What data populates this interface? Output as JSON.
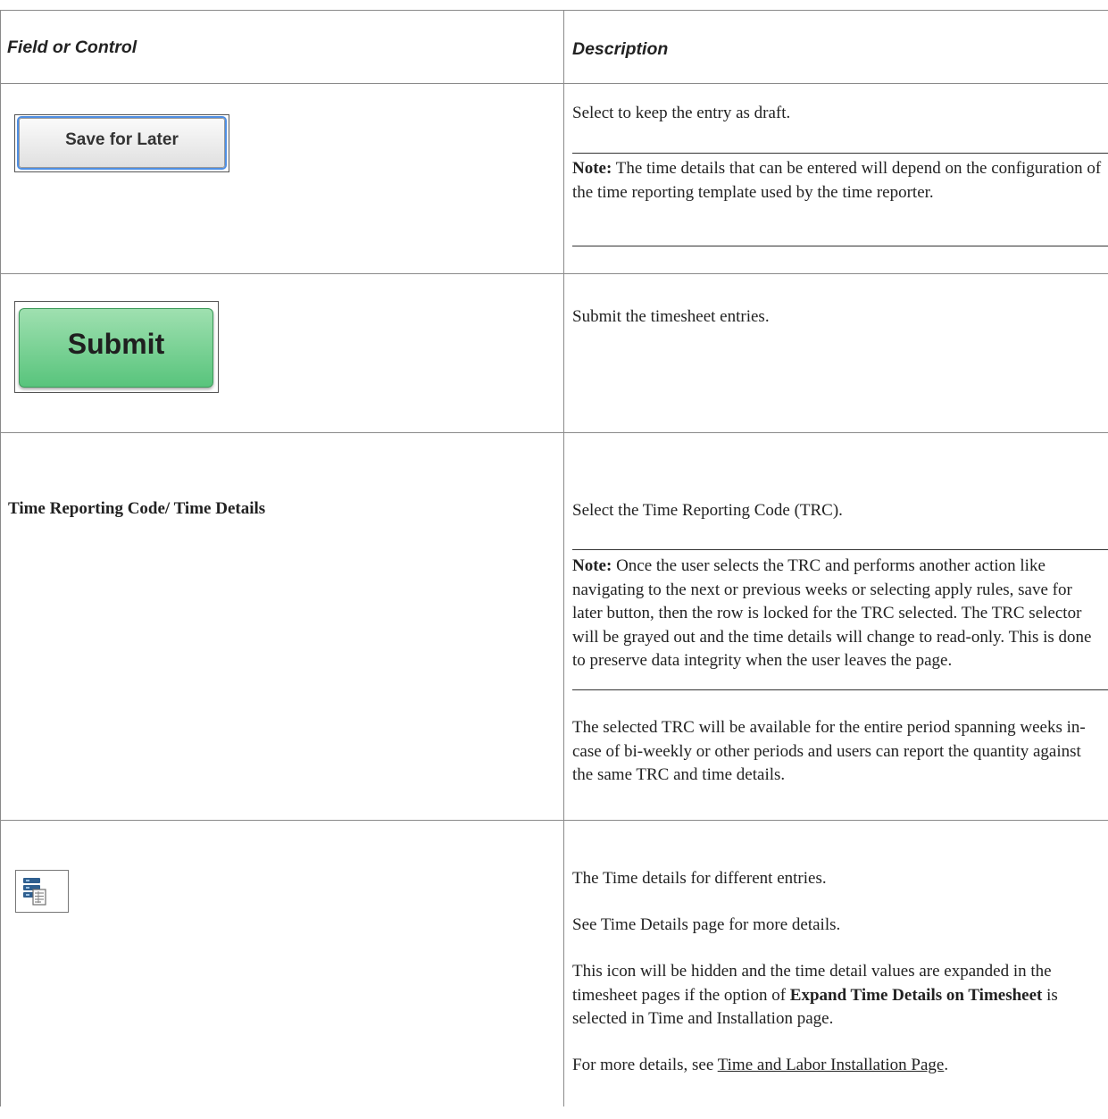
{
  "header": {
    "col1": "Field or Control",
    "col2": "Description"
  },
  "rows": [
    {
      "control": "Save for Later",
      "description": "Select to keep the entry as draft.",
      "note_label": "Note:",
      "note_text": " The time details that can be entered will depend on the configuration of the time reporting template used by the time reporter."
    },
    {
      "control": "Submit",
      "description": "Submit the timesheet entries."
    },
    {
      "control": "Time Reporting Code/ Time Details",
      "description": "Select the Time Reporting Code (TRC).",
      "note_label": "Note:",
      "note_text": " Once the user selects the TRC and performs another action like navigating to the next or previous weeks or selecting apply rules, save for later button, then the row is locked for the TRC selected. The TRC selector will be grayed out and the time details will change to read-only. This is done to preserve data integrity when the user leaves the page.",
      "extra": "The selected TRC will be available for the entire period spanning weeks in-case of bi-weekly or other periods and users can report the quantity against the same TRC and time details."
    },
    {
      "control_icon": "time-details-icon",
      "p1": "The Time details for different entries.",
      "p2": "See Time Details page for more details.",
      "p3_a": "This icon will be hidden and the time detail values are expanded in the timesheet pages if the option of ",
      "p3_bold": "Expand Time Details on Timesheet",
      "p3_b": " is selected in Time and Installation page.",
      "p4_a": "For more details, see ",
      "p4_link": "Time and Labor Installation Page",
      "p4_b": "."
    }
  ],
  "colors": {
    "border": "#8a8a8a",
    "save_focus": "#4f8fe3",
    "submit_green": "#58c47c",
    "icon_blue": "#2f5f8f"
  }
}
